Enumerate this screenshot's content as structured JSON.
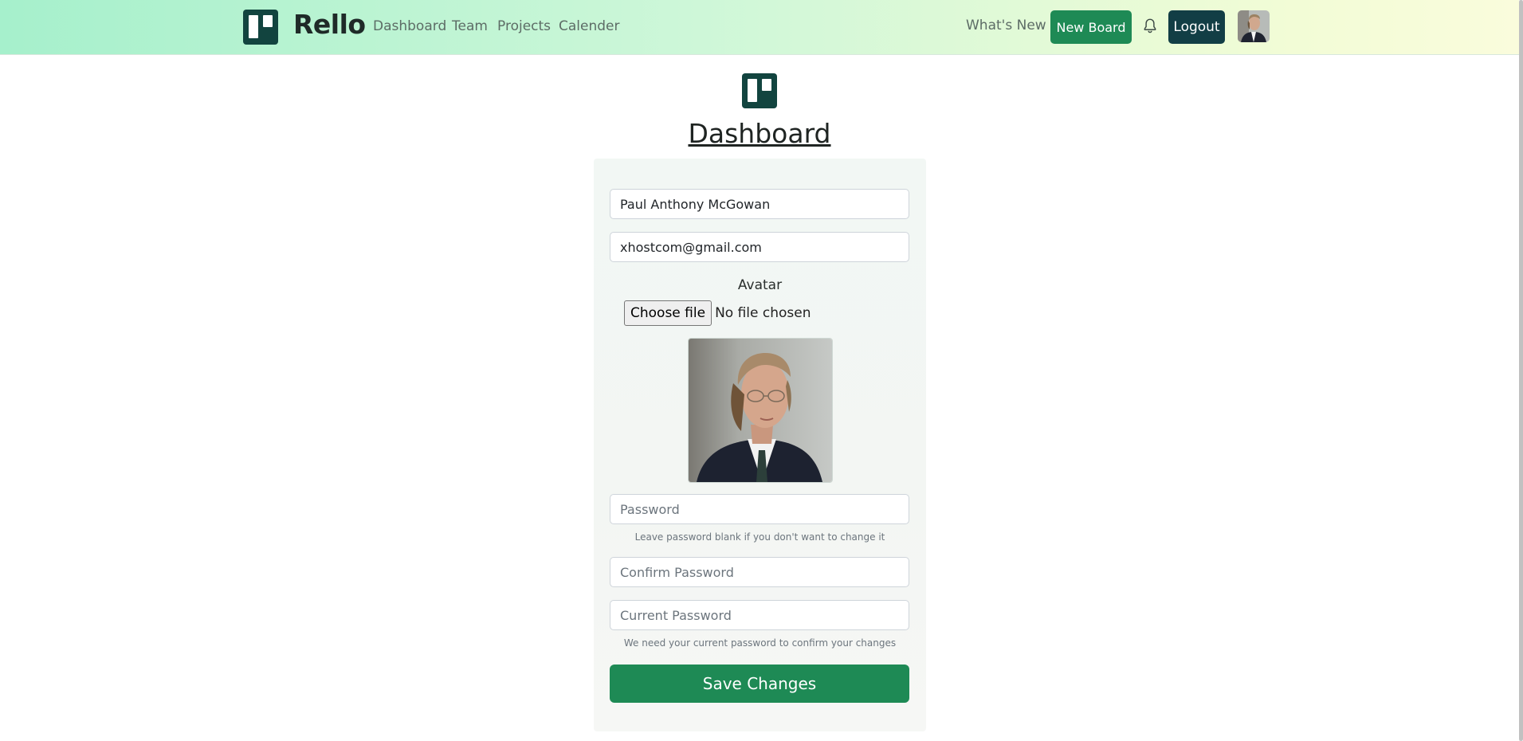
{
  "navbar": {
    "brand": "Rello",
    "links": [
      "Dashboard",
      "Team",
      "Projects",
      "Calender"
    ],
    "whats_new": "What's New",
    "new_board": "New Board",
    "logout": "Logout",
    "icons": {
      "logo": "trello-logo-icon",
      "bell": "bell-icon",
      "avatar": "user-avatar"
    }
  },
  "page": {
    "title": "Dashboard"
  },
  "form": {
    "name_value": "Paul Anthony McGowan",
    "email_value": "xhostcom@gmail.com",
    "avatar_label": "Avatar",
    "choose_file_label": "Choose file",
    "file_status": "No file chosen",
    "password_placeholder": "Password",
    "password_help": "Leave password blank if you don't want to change it",
    "confirm_password_placeholder": "Confirm Password",
    "current_password_placeholder": "Current Password",
    "current_password_help": "We need your current password to confirm your changes",
    "save_label": "Save Changes"
  },
  "colors": {
    "accent_green": "#1e8a55",
    "dark_teal": "#123e45",
    "logo_teal": "#12443f"
  }
}
